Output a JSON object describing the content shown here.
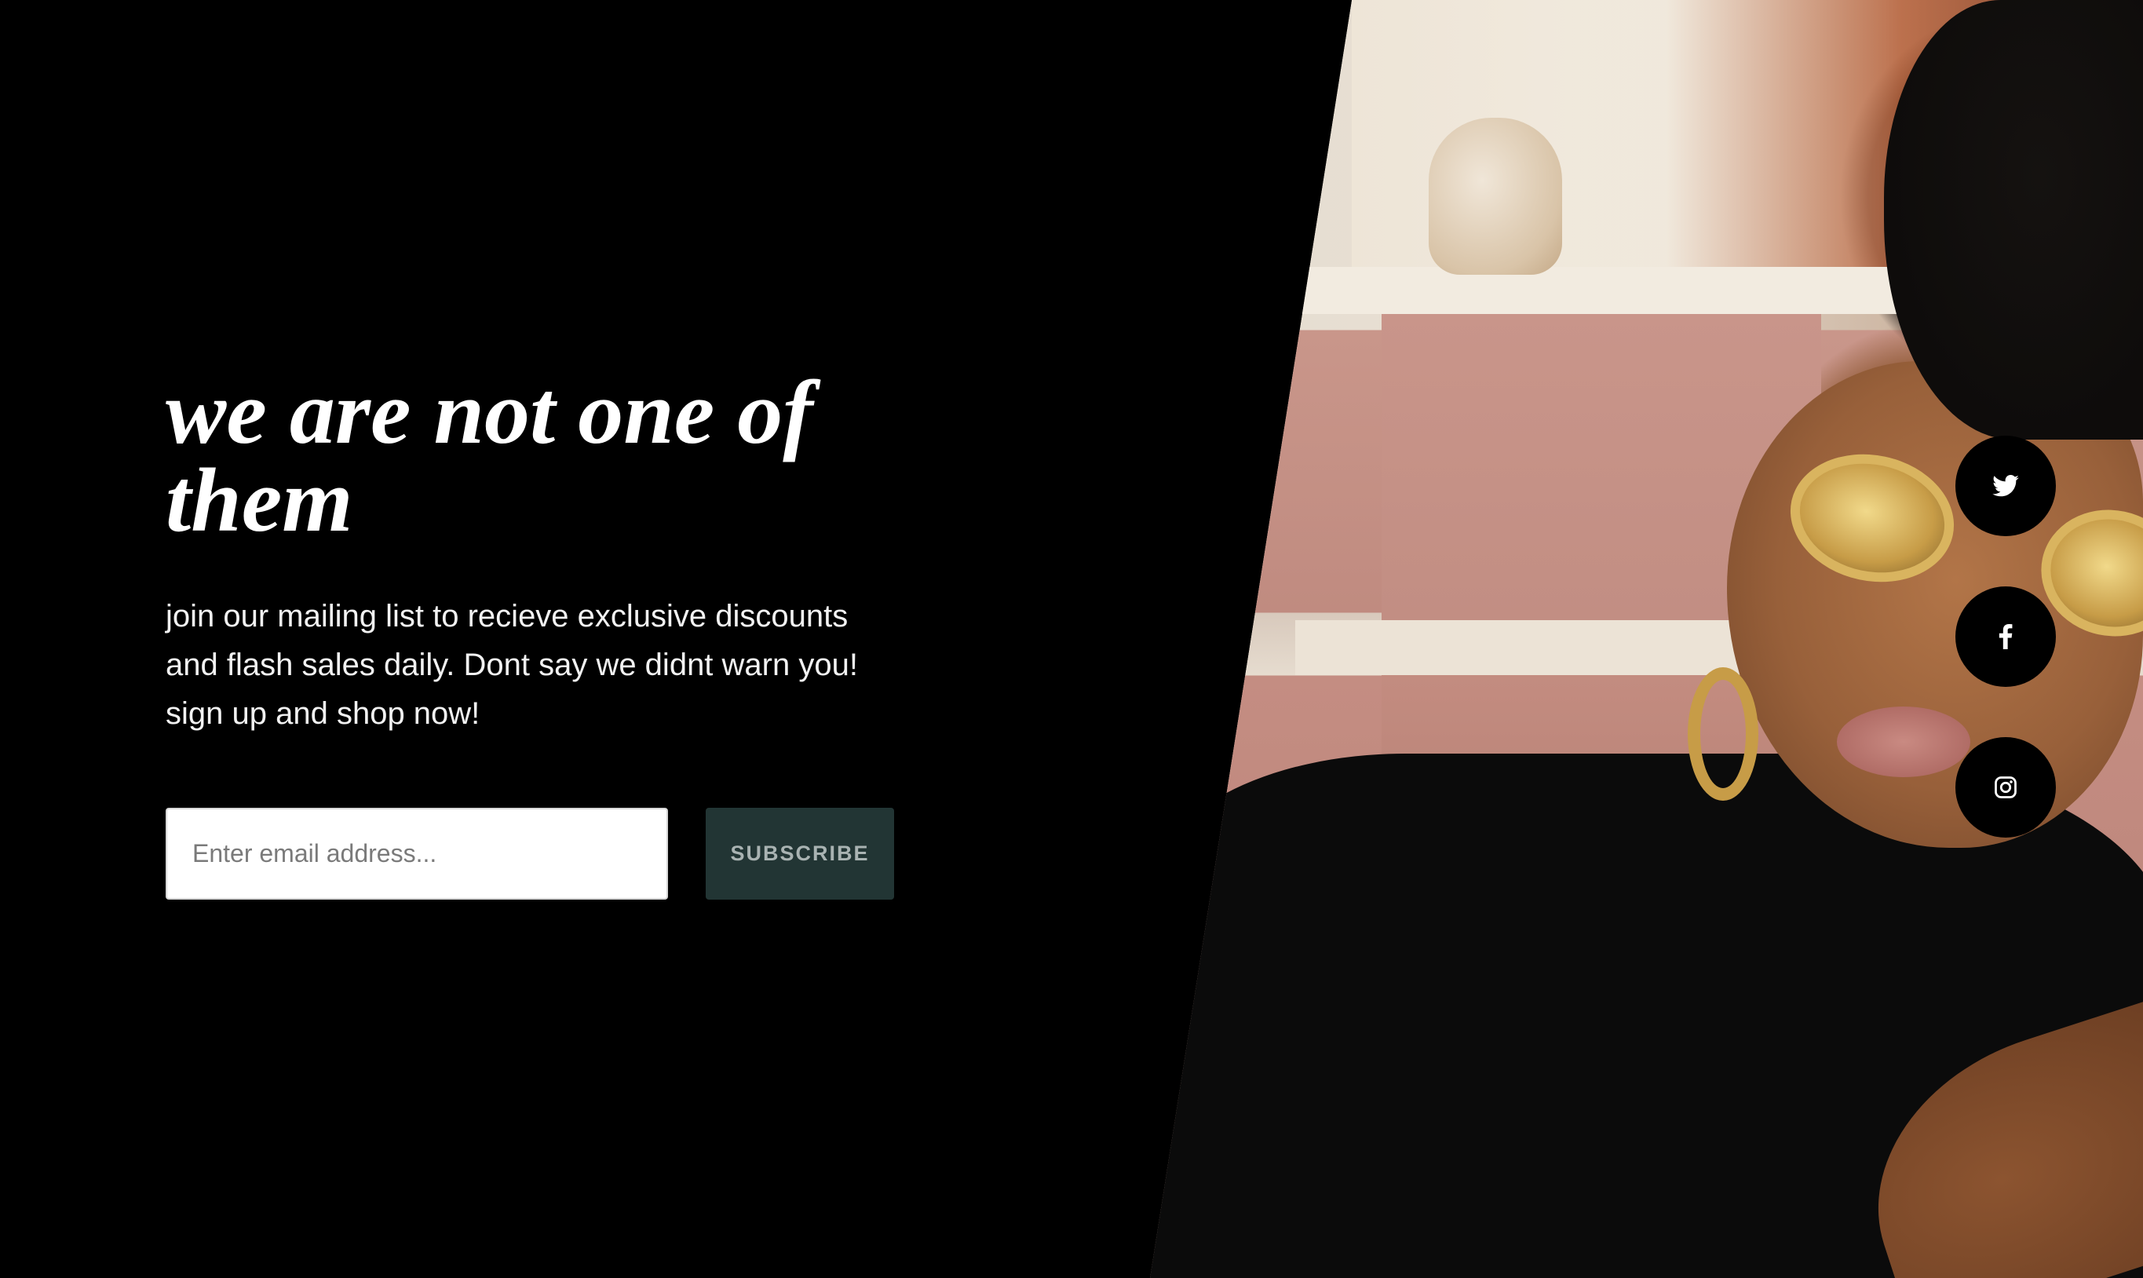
{
  "signup": {
    "headline": "we are not one of them",
    "body": "join our mailing list to recieve exclusive discounts and flash sales daily. Dont say we didnt warn you! sign up and shop now!",
    "email_placeholder": "Enter email address...",
    "email_value": "",
    "subscribe_label": "SUBSCRIBE"
  },
  "social": {
    "items": [
      {
        "icon": "twitter-icon"
      },
      {
        "icon": "facebook-icon"
      },
      {
        "icon": "instagram-icon"
      }
    ]
  },
  "colors": {
    "background": "#000000",
    "subscribe_button": "#223534",
    "subscribe_text": "#a9b3b2",
    "text": "#ffffff"
  }
}
